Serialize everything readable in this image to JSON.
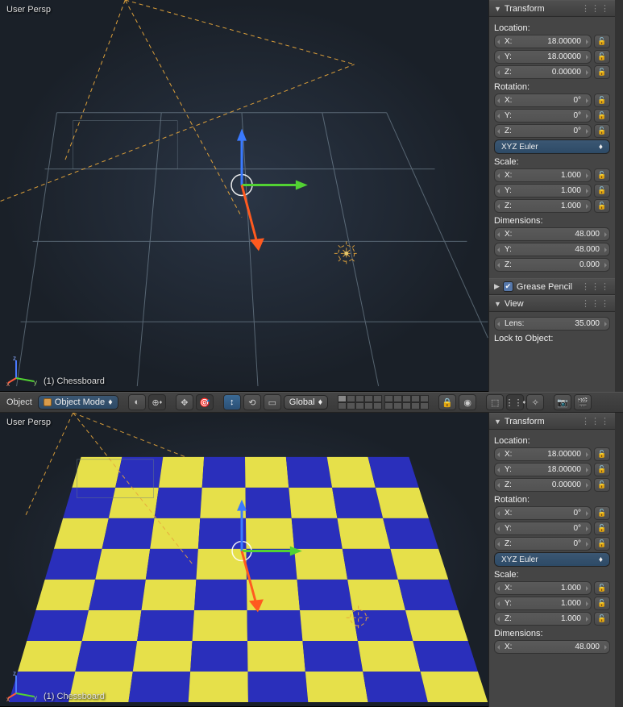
{
  "viewport_top": {
    "persp_label": "User Persp",
    "object_label": "(1) Chessboard"
  },
  "viewport_bottom": {
    "persp_label": "User Persp",
    "object_label": "(1) Chessboard"
  },
  "header": {
    "object_label": "Object",
    "mode_label": "Object Mode",
    "orientation_label": "Global"
  },
  "transform_panel_top": {
    "title": "Transform",
    "location_label": "Location:",
    "location": {
      "x_k": "X:",
      "x_v": "18.00000",
      "y_k": "Y:",
      "y_v": "18.00000",
      "z_k": "Z:",
      "z_v": "0.00000"
    },
    "rotation_label": "Rotation:",
    "rotation": {
      "x_k": "X:",
      "x_v": "0°",
      "y_k": "Y:",
      "y_v": "0°",
      "z_k": "Z:",
      "z_v": "0°"
    },
    "rotation_mode": "XYZ Euler",
    "scale_label": "Scale:",
    "scale": {
      "x_k": "X:",
      "x_v": "1.000",
      "y_k": "Y:",
      "y_v": "1.000",
      "z_k": "Z:",
      "z_v": "1.000"
    },
    "dimensions_label": "Dimensions:",
    "dimensions": {
      "x_k": "X:",
      "x_v": "48.000",
      "y_k": "Y:",
      "y_v": "48.000",
      "z_k": "Z:",
      "z_v": "0.000"
    }
  },
  "grease_panel": {
    "title": "Grease Pencil"
  },
  "view_panel": {
    "title": "View",
    "lens_label": "Lens:",
    "lens_value": "35.000",
    "lock_label": "Lock to Object:"
  },
  "transform_panel_bottom": {
    "title": "Transform",
    "location_label": "Location:",
    "location": {
      "x_k": "X:",
      "x_v": "18.00000",
      "y_k": "Y:",
      "y_v": "18.00000",
      "z_k": "Z:",
      "z_v": "0.00000"
    },
    "rotation_label": "Rotation:",
    "rotation": {
      "x_k": "X:",
      "x_v": "0°",
      "y_k": "Y:",
      "y_v": "0°",
      "z_k": "Z:",
      "z_v": "0°"
    },
    "rotation_mode": "XYZ Euler",
    "scale_label": "Scale:",
    "scale": {
      "x_k": "X:",
      "x_v": "1.000",
      "y_k": "Y:",
      "y_v": "1.000",
      "z_k": "Z:",
      "z_v": "1.000"
    },
    "dimensions_label": "Dimensions:",
    "dimensions": {
      "x_k": "X:",
      "x_v": "48.000"
    }
  },
  "icons": {
    "lock": "🔓",
    "dropdown_updown": "♦",
    "check": "✔",
    "arrow_down": "▼",
    "arrow_right": "▶"
  }
}
